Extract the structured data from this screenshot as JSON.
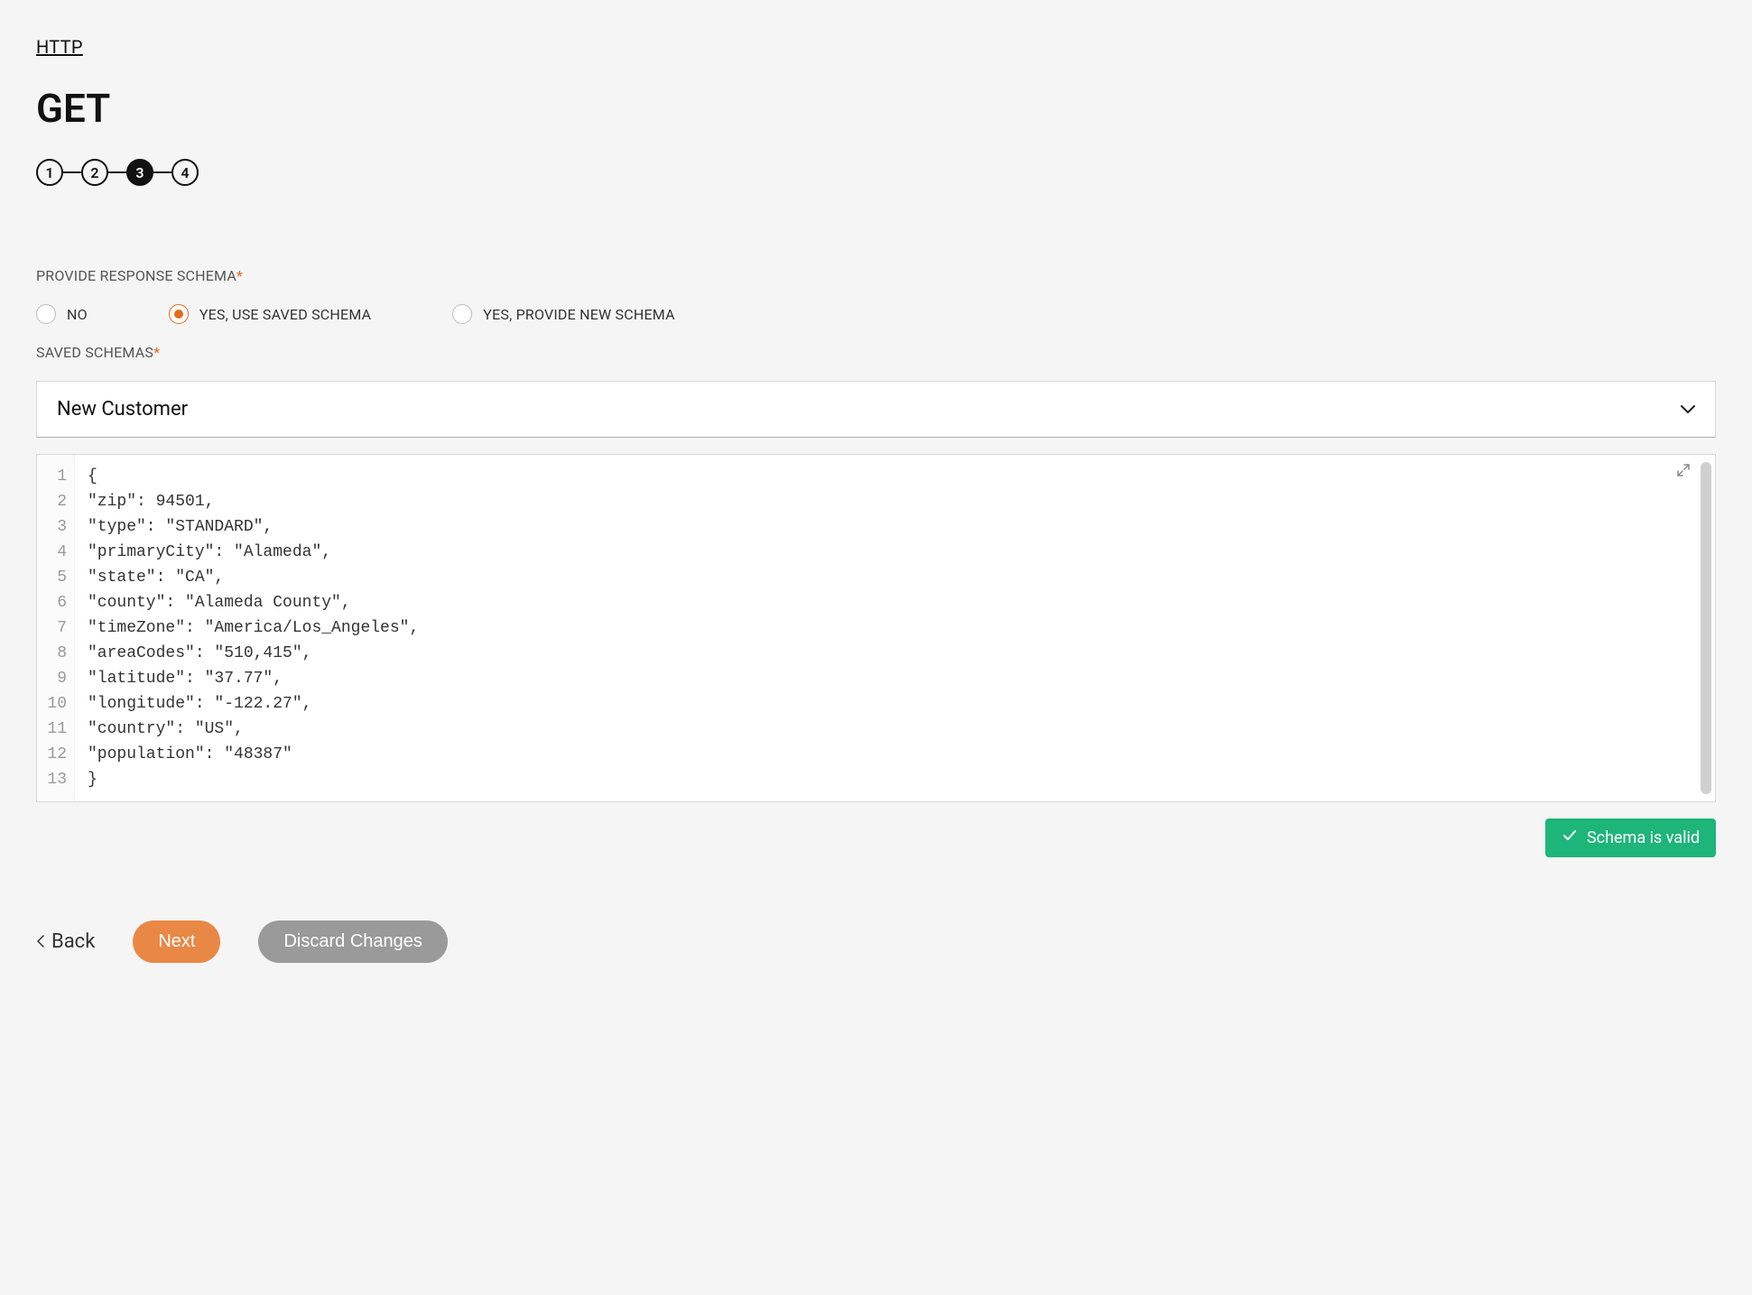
{
  "breadcrumb": "HTTP",
  "title": "GET",
  "stepper": {
    "steps": [
      "1",
      "2",
      "3",
      "4"
    ],
    "active_index": 2
  },
  "labels": {
    "provide_response_schema": "PROVIDE RESPONSE SCHEMA",
    "saved_schemas": "SAVED SCHEMAS"
  },
  "schema_radio": {
    "options": [
      {
        "label": "NO",
        "selected": false
      },
      {
        "label": "YES, USE SAVED SCHEMA",
        "selected": true
      },
      {
        "label": "YES, PROVIDE NEW SCHEMA",
        "selected": false
      }
    ]
  },
  "saved_schema_dropdown": {
    "value": "New Customer"
  },
  "code_editor": {
    "lines": [
      "{",
      "\"zip\": 94501,",
      "\"type\": \"STANDARD\",",
      "\"primaryCity\": \"Alameda\",",
      "\"state\": \"CA\",",
      "\"county\": \"Alameda County\",",
      "\"timeZone\": \"America/Los_Angeles\",",
      "\"areaCodes\": \"510,415\",",
      "\"latitude\": \"37.77\",",
      "\"longitude\": \"-122.27\",",
      "\"country\": \"US\",",
      "\"population\": \"48387\"",
      "}"
    ]
  },
  "validation": {
    "message": "Schema is valid"
  },
  "footer": {
    "back": "Back",
    "next": "Next",
    "discard": "Discard Changes"
  }
}
